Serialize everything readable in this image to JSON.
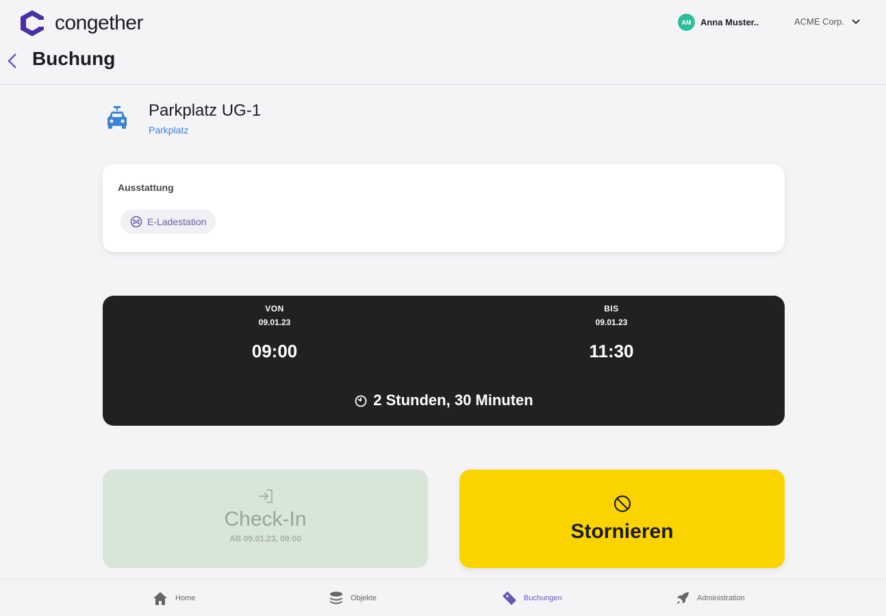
{
  "brand": {
    "name": "congether",
    "color": "#4b2fa8"
  },
  "user": {
    "initials": "AM",
    "name": "Anna Muster..",
    "avatar_color": "#2bbf9b"
  },
  "org": {
    "name": "ACME Corp."
  },
  "page": {
    "title": "Buchung"
  },
  "object": {
    "title": "Parkplatz UG-1",
    "type": "Parkplatz",
    "icon": "car-icon"
  },
  "equipment": {
    "label": "Ausstattung",
    "items": [
      {
        "label": "E-Ladestation",
        "icon": "charging-icon"
      }
    ]
  },
  "time": {
    "from": {
      "label": "VON",
      "date": "09.01.23",
      "time": "09:00"
    },
    "to": {
      "label": "BIS",
      "date": "09.01.23",
      "time": "11:30"
    },
    "duration": "2 Stunden, 30 Minuten"
  },
  "actions": {
    "checkin": {
      "label": "Check-In",
      "sub": "AB 09.01.23, 09:00",
      "disabled": true
    },
    "cancel": {
      "label": "Stornieren",
      "color": "#fbd400"
    }
  },
  "nav": {
    "items": [
      {
        "label": "Home",
        "icon": "home-icon"
      },
      {
        "label": "Objekte",
        "icon": "layers-icon"
      },
      {
        "label": "Buchungen",
        "icon": "ticket-icon",
        "active": true
      },
      {
        "label": "Administration",
        "icon": "rocket-icon"
      }
    ]
  }
}
